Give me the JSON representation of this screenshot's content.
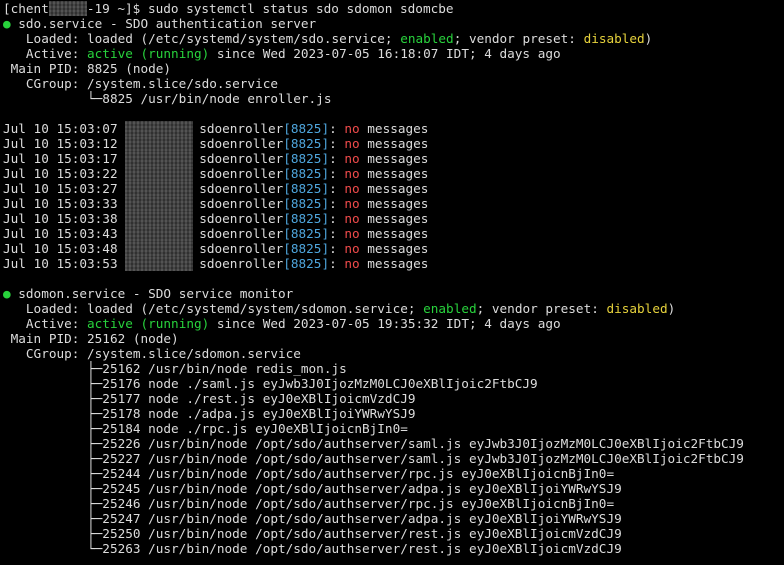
{
  "prompt": {
    "open": "[chent",
    "rest": "-19 ~]$ sudo systemctl status sdo sdomon sdomcbe"
  },
  "colors": {
    "green": "#28d23c",
    "yellow": "#e6d23c",
    "red": "#f04b4b",
    "cyan": "#4ea5dc",
    "text": "#dcdcdc"
  },
  "services": [
    {
      "bullet": "●",
      "header": "sdo.service - SDO authentication server",
      "loaded_label": "   Loaded: ",
      "loaded_pre": "loaded (/etc/systemd/system/sdo.service; ",
      "enabled": "enabled",
      "loaded_mid": "; vendor preset: ",
      "preset": "disabled",
      "loaded_post": ")",
      "active_label": "   Active: ",
      "active_state": "active (running)",
      "active_since": " since Wed 2023-07-05 16:18:07 IDT; 4 days ago",
      "main_pid": " Main PID: 8825 (node)",
      "cgroup": "   CGroup: /system.slice/sdo.service",
      "processes": [
        "           └─8825 /usr/bin/node enroller.js"
      ]
    },
    {
      "bullet": "●",
      "header": "sdomon.service - SDO service monitor",
      "loaded_label": "   Loaded: ",
      "loaded_pre": "loaded (/etc/systemd/system/sdomon.service; ",
      "enabled": "enabled",
      "loaded_mid": "; vendor preset: ",
      "preset": "disabled",
      "loaded_post": ")",
      "active_label": "   Active: ",
      "active_state": "active (running)",
      "active_since": " since Wed 2023-07-05 19:35:32 IDT; 4 days ago",
      "main_pid": " Main PID: 25162 (node)",
      "cgroup": "   CGroup: /system.slice/sdomon.service",
      "processes": [
        "           ├─25162 /usr/bin/node redis_mon.js",
        "           ├─25176 node ./saml.js eyJwb3J0IjozMzM0LCJ0eXBlIjoic2FtbCJ9",
        "           ├─25177 node ./rest.js eyJ0eXBlIjoicmVzdCJ9",
        "           ├─25178 node ./adpa.js eyJ0eXBlIjoiYWRwYSJ9",
        "           ├─25184 node ./rpc.js eyJ0eXBlIjoicnBjIn0=",
        "           ├─25226 /usr/bin/node /opt/sdo/authserver/saml.js eyJwb3J0IjozMzM0LCJ0eXBlIjoic2FtbCJ9",
        "           ├─25227 /usr/bin/node /opt/sdo/authserver/saml.js eyJwb3J0IjozMzM0LCJ0eXBlIjoic2FtbCJ9",
        "           ├─25244 /usr/bin/node /opt/sdo/authserver/rpc.js eyJ0eXBlIjoicnBjIn0=",
        "           ├─25245 /usr/bin/node /opt/sdo/authserver/adpa.js eyJ0eXBlIjoiYWRwYSJ9",
        "           ├─25246 /usr/bin/node /opt/sdo/authserver/rpc.js eyJ0eXBlIjoicnBjIn0=",
        "           ├─25247 /usr/bin/node /opt/sdo/authserver/adpa.js eyJ0eXBlIjoiYWRwYSJ9",
        "           ├─25250 /usr/bin/node /opt/sdo/authserver/rest.js eyJ0eXBlIjoicmVzdCJ9",
        "           └─25263 /usr/bin/node /opt/sdo/authserver/rest.js eyJ0eXBlIjoicmVzdCJ9"
      ]
    }
  ],
  "log": {
    "process": "sdoenroller",
    "pid": "[8825]",
    "sep": ": ",
    "msg_no": "no",
    "msg_rest": " messages",
    "entries": [
      "Jul 10 15:03:07 ",
      "Jul 10 15:03:12 ",
      "Jul 10 15:03:17 ",
      "Jul 10 15:03:22 ",
      "Jul 10 15:03:27 ",
      "Jul 10 15:03:33 ",
      "Jul 10 15:03:38 ",
      "Jul 10 15:03:43 ",
      "Jul 10 15:03:48 ",
      "Jul 10 15:03:53 "
    ]
  }
}
